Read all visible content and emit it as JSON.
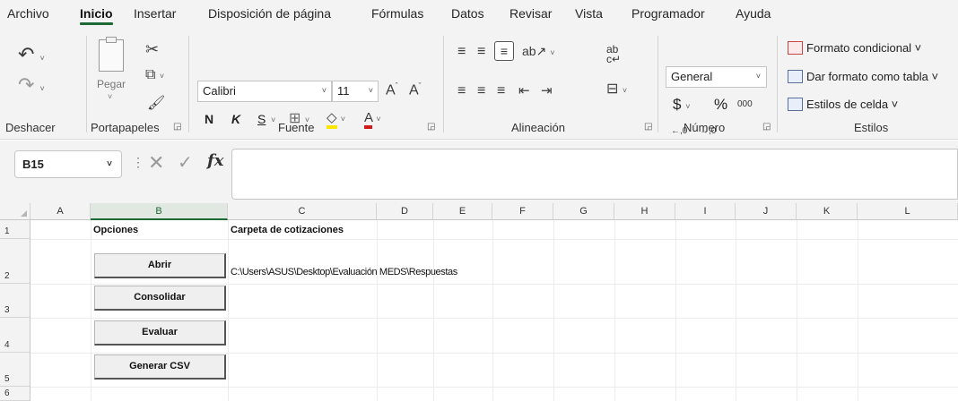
{
  "menu": {
    "tabs": [
      "Archivo",
      "Inicio",
      "Insertar",
      "Disposición de página",
      "Fórmulas",
      "Datos",
      "Revisar",
      "Vista",
      "Programador",
      "Ayuda"
    ],
    "active": "Inicio"
  },
  "ribbon": {
    "groups": {
      "deshacer": "Deshacer",
      "portapapeles": "Portapapeles",
      "fuente": "Fuente",
      "alineacion": "Alineación",
      "numero": "Número",
      "estilos": "Estilos"
    },
    "clipboard": {
      "paste_label": "Pegar"
    },
    "font": {
      "name": "Calibri",
      "size": "11",
      "bold": "N",
      "italic": "K",
      "underline": "S"
    },
    "number": {
      "format": "General",
      "currency": "$",
      "percent": "%",
      "thousands": "000",
      "inc_decimal": "←,0 ,00",
      "dec_decimal": ",00 →,0"
    },
    "styles": {
      "conditional": "Formato condicional ˅",
      "as_table": "Dar formato como tabla ˅",
      "cell_styles": "Estilos de celda ˅"
    }
  },
  "formula_bar": {
    "name_box": "B15",
    "fx": "fx",
    "formula": ""
  },
  "grid": {
    "columns": [
      "A",
      "B",
      "C",
      "D",
      "E",
      "F",
      "G",
      "H",
      "I",
      "J",
      "K",
      "L"
    ],
    "selected_column": "B",
    "rows": [
      "1",
      "2",
      "3",
      "4",
      "5",
      "6"
    ],
    "cells": {
      "B1": "Opciones",
      "C1": "Carpeta de cotizaciones",
      "C2": "C:\\Users\\ASUS\\Desktop\\Evaluación MEDS\\Respuestas"
    },
    "buttons": {
      "abrir": "Abrir",
      "consolidar": "Consolidar",
      "evaluar": "Evaluar",
      "generar_csv": "Generar CSV"
    }
  },
  "colors": {
    "accent": "#1e6a35",
    "ribbon_bg": "#f3f3f3",
    "grid_line": "#ececec"
  }
}
